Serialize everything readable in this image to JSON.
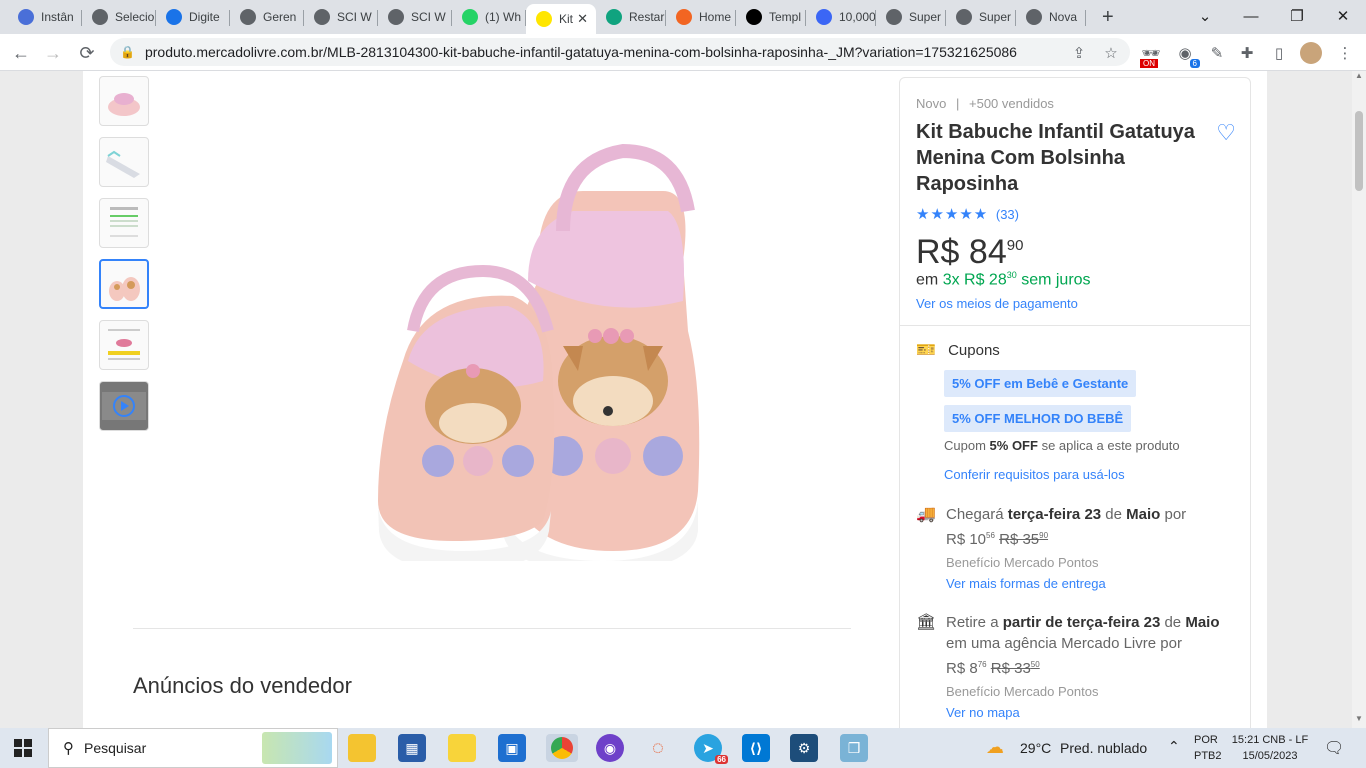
{
  "tabs": [
    {
      "label": "Instân",
      "icon": "gear-icon",
      "color": "#4a6fd8"
    },
    {
      "label": "Selecio",
      "icon": "globe-icon",
      "color": "#5f6368"
    },
    {
      "label": "Digite",
      "icon": "docs-icon",
      "color": "#1a73e8"
    },
    {
      "label": "Geren",
      "icon": "globe-icon",
      "color": "#5f6368"
    },
    {
      "label": "SCI W",
      "icon": "globe-icon",
      "color": "#5f6368"
    },
    {
      "label": "SCI W",
      "icon": "globe-icon",
      "color": "#5f6368"
    },
    {
      "label": "(1) Wh",
      "icon": "whatsapp-icon",
      "color": "#25d366"
    },
    {
      "label": "Kit",
      "icon": "mercadolivre-icon",
      "color": "#ffe600"
    },
    {
      "label": "Restar",
      "icon": "openai-icon",
      "color": "#10a37f"
    },
    {
      "label": "Home",
      "icon": "swirl-icon",
      "color": "#f26522"
    },
    {
      "label": "Templ",
      "icon": "wix-icon",
      "color": "#000000"
    },
    {
      "label": "10,000",
      "icon": "notion-icon",
      "color": "#3b66f5"
    },
    {
      "label": "Super",
      "icon": "globe-icon",
      "color": "#5f6368"
    },
    {
      "label": "Super",
      "icon": "globe-icon",
      "color": "#5f6368"
    },
    {
      "label": "Nova",
      "icon": "chrome-icon",
      "color": "#5f6368"
    }
  ],
  "new_tab": "+",
  "window_controls": {
    "dropdown": "⌄",
    "minimize": "—",
    "restore": "❐",
    "close": "✕"
  },
  "url": "produto.mercadolivre.com.br/MLB-2813104300-kit-babuche-infantil-gatatuya-menina-com-bolsinha-raposinha-_JM?variation=175321625086",
  "extension_badge": "6",
  "extension_on": "ON",
  "product": {
    "condition": "Novo",
    "sold": "+500 vendidos",
    "title": "Kit Babuche Infantil Gatatuya Menina Com Bolsinha Raposinha",
    "rating_count": "(33)",
    "rating": 5,
    "price_symbol": "R$",
    "price_int": "84",
    "price_cents": "90",
    "installments_pre": "em",
    "installments": "3x R$ 28",
    "installments_cents": "30",
    "installments_post": "sem juros",
    "payment_link": "Ver os meios de pagamento",
    "coupons_label": "Cupons",
    "coupon1": "5% OFF em Bebê e Gestante",
    "coupon2": "5% OFF MELHOR DO BEBÊ",
    "coupon_note_pre": "Cupom",
    "coupon_note_bold": "5% OFF",
    "coupon_note_post": "se aplica a este produto",
    "coupon_link": "Conferir requisitos para usá-los",
    "delivery_pre": "Chegará",
    "delivery_day": "terça-feira",
    "delivery_date": "23",
    "delivery_de": "de",
    "delivery_month": "Maio",
    "delivery_por": "por",
    "delivery_price": "R$ 10",
    "delivery_price_cents": "56",
    "delivery_old": "R$ 35",
    "delivery_old_cents": "90",
    "delivery_benefit": "Benefício Mercado Pontos",
    "delivery_link": "Ver mais formas de entrega",
    "pickup_pre": "Retire",
    "pickup_a": "a",
    "pickup_partir": "partir de terça-feira",
    "pickup_date": "23",
    "pickup_de": "de",
    "pickup_month": "Maio",
    "pickup_line2": "em uma agência Mercado Livre por",
    "pickup_price": "R$ 8",
    "pickup_price_cents": "76",
    "pickup_old": "R$ 33",
    "pickup_old_cents": "50",
    "pickup_benefit": "Benefício Mercado Pontos",
    "pickup_link": "Ver no mapa"
  },
  "seller_ads_heading": "Anúncios do vendedor",
  "taskbar": {
    "search_placeholder": "Pesquisar",
    "weather_temp": "29°C",
    "weather_desc": "Pred. nublado",
    "lang": "POR",
    "layout": "PTB2",
    "time": "15:21 CNB - LF",
    "date": "15/05/2023",
    "telegram_badge": "66"
  }
}
